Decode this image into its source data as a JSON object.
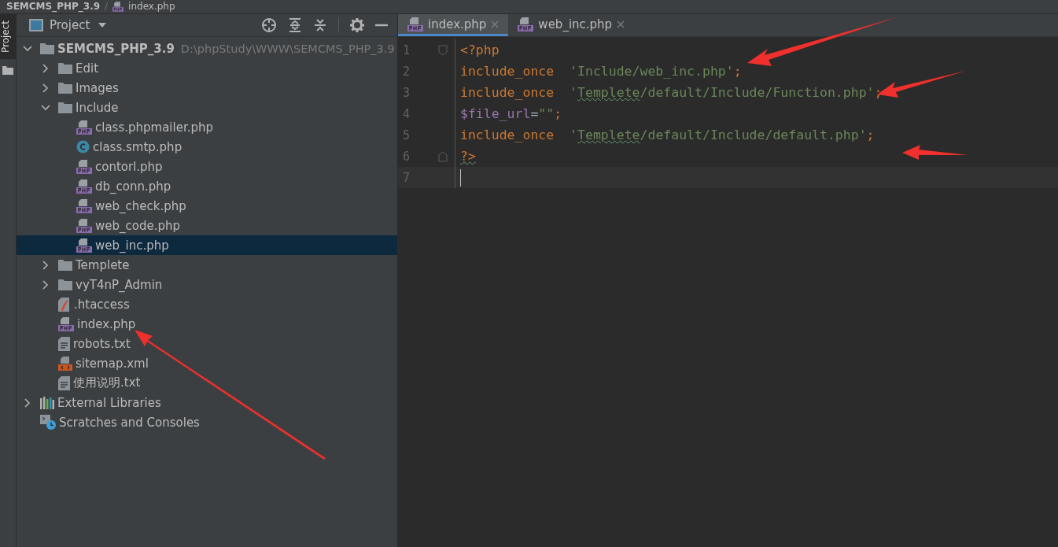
{
  "breadcrumb": {
    "separator": "/",
    "items": [
      {
        "label": "SEMCMS_PHP_3.9",
        "kind": "folder"
      },
      {
        "label": "index.php",
        "kind": "php"
      }
    ]
  },
  "side_strip": {
    "tab": "Project"
  },
  "project_panel": {
    "title": "Project",
    "tree": [
      {
        "label": "SEMCMS_PHP_3.9",
        "path": "D:\\phpStudy\\WWW\\SEMCMS_PHP_3.9",
        "kind": "root",
        "expanded": true,
        "selected": false,
        "children": [
          {
            "label": "Edit",
            "kind": "folder",
            "expanded": false,
            "selected": false
          },
          {
            "label": "Images",
            "kind": "folder",
            "expanded": false,
            "selected": false
          },
          {
            "label": "Include",
            "kind": "folder",
            "expanded": true,
            "selected": false,
            "children": [
              {
                "label": "class.phpmailer.php",
                "kind": "php",
                "selected": false
              },
              {
                "label": "class.smtp.php",
                "kind": "class",
                "selected": false
              },
              {
                "label": "contorl.php",
                "kind": "php",
                "selected": false
              },
              {
                "label": "db_conn.php",
                "kind": "php",
                "selected": false
              },
              {
                "label": "web_check.php",
                "kind": "php",
                "selected": false
              },
              {
                "label": "web_code.php",
                "kind": "php",
                "selected": false
              },
              {
                "label": "web_inc.php",
                "kind": "php",
                "selected": true
              }
            ]
          },
          {
            "label": "Templete",
            "kind": "folder",
            "expanded": false,
            "selected": false
          },
          {
            "label": "vyT4nP_Admin",
            "kind": "folder",
            "expanded": false,
            "selected": false
          },
          {
            "label": ".htaccess",
            "kind": "htaccess",
            "selected": false
          },
          {
            "label": "index.php",
            "kind": "php",
            "selected": false
          },
          {
            "label": "robots.txt",
            "kind": "txt",
            "selected": false
          },
          {
            "label": "sitemap.xml",
            "kind": "xml",
            "selected": false
          },
          {
            "label": "使用说明.txt",
            "kind": "txt",
            "selected": false
          }
        ]
      },
      {
        "label": "External Libraries",
        "kind": "libraries",
        "expanded": false,
        "selected": false
      },
      {
        "label": "Scratches and Consoles",
        "kind": "scratches",
        "selected": false
      }
    ]
  },
  "editor": {
    "tabs": [
      {
        "label": "index.php",
        "selected": true
      },
      {
        "label": "web_inc.php",
        "selected": false
      }
    ],
    "lines": [
      {
        "number": "1",
        "current": false,
        "tokens": [
          {
            "kind": "tag",
            "text": "<?php"
          }
        ]
      },
      {
        "number": "2",
        "current": false,
        "tokens": [
          {
            "kind": "keyword",
            "text": "include_once"
          },
          {
            "kind": "string",
            "text": "  'Include/web_inc.php'"
          },
          {
            "kind": "keyword",
            "text": ";"
          }
        ]
      },
      {
        "number": "3",
        "current": false,
        "tokens": [
          {
            "kind": "keyword",
            "text": "include_once"
          },
          {
            "kind": "string",
            "text": "  '"
          },
          {
            "kind": "misspelled_string",
            "text": "Templete"
          },
          {
            "kind": "string",
            "text": "/default/Include/Function.php'"
          },
          {
            "kind": "keyword",
            "text": ";"
          }
        ]
      },
      {
        "number": "4",
        "current": false,
        "tokens": [
          {
            "kind": "variable",
            "text": "$file_url"
          },
          {
            "kind": "plain",
            "text": "="
          },
          {
            "kind": "string",
            "text": "\"\""
          },
          {
            "kind": "keyword",
            "text": ";"
          }
        ]
      },
      {
        "number": "5",
        "current": false,
        "tokens": [
          {
            "kind": "keyword",
            "text": "include_once"
          },
          {
            "kind": "string",
            "text": "  '"
          },
          {
            "kind": "misspelled_string",
            "text": "Templete"
          },
          {
            "kind": "string",
            "text": "/default/Include/default.php'"
          },
          {
            "kind": "keyword",
            "text": ";"
          }
        ]
      },
      {
        "number": "6",
        "current": false,
        "tokens": [
          {
            "kind": "warned_tag",
            "text": "?>"
          }
        ]
      },
      {
        "number": "7",
        "current": true
      }
    ]
  }
}
